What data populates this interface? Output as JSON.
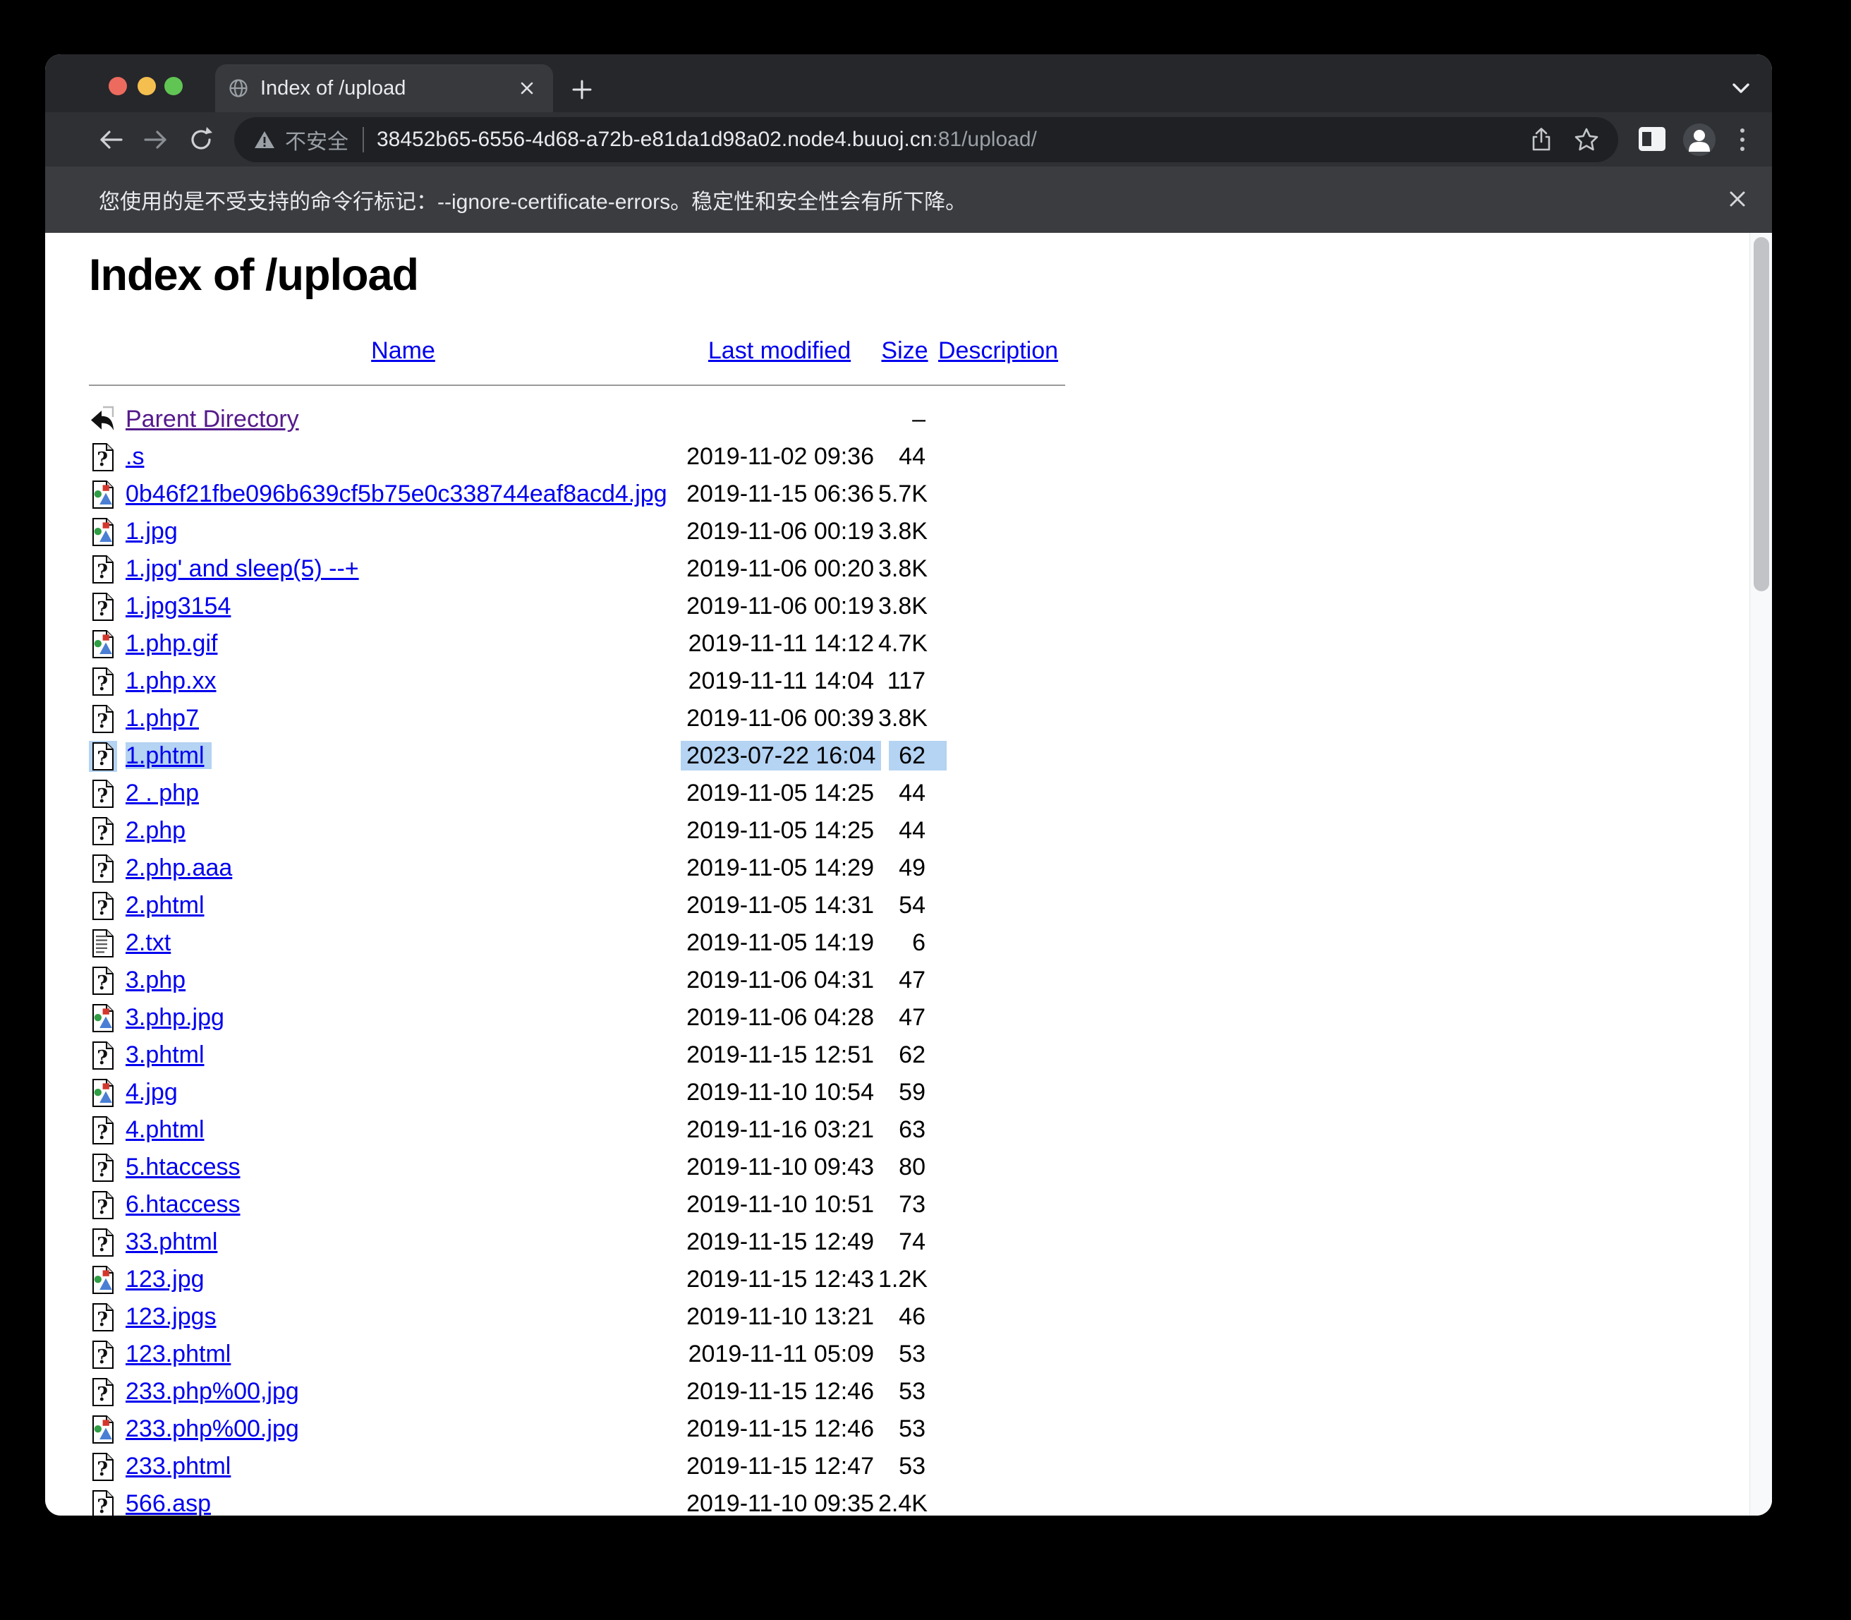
{
  "window": {
    "traffic_lights": {
      "close": "#ed6a5e",
      "minimize": "#f4bf4f",
      "zoom": "#61c554"
    }
  },
  "tab": {
    "title": "Index of /upload",
    "favicon": "globe-icon"
  },
  "toolbar": {
    "security_label": "不安全",
    "url_host": "38452b65-6556-4d68-a72b-e81da1d98a02.node4.buuoj.cn",
    "url_path": ":81/upload/"
  },
  "infobar": {
    "message": "您使用的是不受支持的命令行标记：--ignore-certificate-errors。稳定性和安全性会有所下降。"
  },
  "page": {
    "heading": "Index of /upload",
    "columns": {
      "name": "Name",
      "modified": "Last modified",
      "size": "Size",
      "description": "Description"
    },
    "rows": [
      {
        "icon": "back",
        "name": "Parent Directory",
        "modified": "",
        "size": "–",
        "visited": true,
        "selected": false
      },
      {
        "icon": "unknown",
        "name": ".s",
        "modified": "2019-11-02 09:36",
        "size": "44",
        "visited": false,
        "selected": false
      },
      {
        "icon": "image",
        "name": "0b46f21fbe096b639cf5b75e0c338744eaf8acd4.jpg",
        "modified": "2019-11-15 06:36",
        "size": "5.7K",
        "visited": false,
        "selected": false
      },
      {
        "icon": "image",
        "name": "1.jpg",
        "modified": "2019-11-06 00:19",
        "size": "3.8K",
        "visited": false,
        "selected": false
      },
      {
        "icon": "unknown",
        "name": "1.jpg' and sleep(5) --+",
        "modified": "2019-11-06 00:20",
        "size": "3.8K",
        "visited": false,
        "selected": false
      },
      {
        "icon": "unknown",
        "name": "1.jpg3154",
        "modified": "2019-11-06 00:19",
        "size": "3.8K",
        "visited": false,
        "selected": false
      },
      {
        "icon": "image",
        "name": "1.php.gif",
        "modified": "2019-11-11 14:12",
        "size": "4.7K",
        "visited": false,
        "selected": false
      },
      {
        "icon": "unknown",
        "name": "1.php.xx",
        "modified": "2019-11-11 14:04",
        "size": "117",
        "visited": false,
        "selected": false
      },
      {
        "icon": "unknown",
        "name": "1.php7",
        "modified": "2019-11-06 00:39",
        "size": "3.8K",
        "visited": false,
        "selected": false
      },
      {
        "icon": "unknown",
        "name": "1.phtml",
        "modified": "2023-07-22 16:04",
        "size": "62",
        "visited": false,
        "selected": true
      },
      {
        "icon": "unknown",
        "name": "2 . php",
        "modified": "2019-11-05 14:25",
        "size": "44",
        "visited": false,
        "selected": false
      },
      {
        "icon": "unknown",
        "name": "2.php",
        "modified": "2019-11-05 14:25",
        "size": "44",
        "visited": false,
        "selected": false
      },
      {
        "icon": "unknown",
        "name": "2.php.aaa",
        "modified": "2019-11-05 14:29",
        "size": "49",
        "visited": false,
        "selected": false
      },
      {
        "icon": "unknown",
        "name": "2.phtml",
        "modified": "2019-11-05 14:31",
        "size": "54",
        "visited": false,
        "selected": false
      },
      {
        "icon": "text",
        "name": "2.txt",
        "modified": "2019-11-05 14:19",
        "size": "6",
        "visited": false,
        "selected": false
      },
      {
        "icon": "unknown",
        "name": "3.php",
        "modified": "2019-11-06 04:31",
        "size": "47",
        "visited": false,
        "selected": false
      },
      {
        "icon": "image",
        "name": "3.php.jpg",
        "modified": "2019-11-06 04:28",
        "size": "47",
        "visited": false,
        "selected": false
      },
      {
        "icon": "unknown",
        "name": "3.phtml",
        "modified": "2019-11-15 12:51",
        "size": "62",
        "visited": false,
        "selected": false
      },
      {
        "icon": "image",
        "name": "4.jpg",
        "modified": "2019-11-10 10:54",
        "size": "59",
        "visited": false,
        "selected": false
      },
      {
        "icon": "unknown",
        "name": "4.phtml",
        "modified": "2019-11-16 03:21",
        "size": "63",
        "visited": false,
        "selected": false
      },
      {
        "icon": "unknown",
        "name": "5.htaccess",
        "modified": "2019-11-10 09:43",
        "size": "80",
        "visited": false,
        "selected": false
      },
      {
        "icon": "unknown",
        "name": "6.htaccess",
        "modified": "2019-11-10 10:51",
        "size": "73",
        "visited": false,
        "selected": false
      },
      {
        "icon": "unknown",
        "name": "33.phtml",
        "modified": "2019-11-15 12:49",
        "size": "74",
        "visited": false,
        "selected": false
      },
      {
        "icon": "image",
        "name": "123.jpg",
        "modified": "2019-11-15 12:43",
        "size": "1.2K",
        "visited": false,
        "selected": false
      },
      {
        "icon": "unknown",
        "name": "123.jpgs",
        "modified": "2019-11-10 13:21",
        "size": "46",
        "visited": false,
        "selected": false
      },
      {
        "icon": "unknown",
        "name": "123.phtml",
        "modified": "2019-11-11 05:09",
        "size": "53",
        "visited": false,
        "selected": false
      },
      {
        "icon": "unknown",
        "name": "233.php%00,jpg",
        "modified": "2019-11-15 12:46",
        "size": "53",
        "visited": false,
        "selected": false
      },
      {
        "icon": "image",
        "name": "233.php%00.jpg",
        "modified": "2019-11-15 12:46",
        "size": "53",
        "visited": false,
        "selected": false
      },
      {
        "icon": "unknown",
        "name": "233.phtml",
        "modified": "2019-11-15 12:47",
        "size": "53",
        "visited": false,
        "selected": false
      },
      {
        "icon": "unknown",
        "name": "566.asp",
        "modified": "2019-11-10 09:35",
        "size": "2.4K",
        "visited": false,
        "selected": false
      }
    ]
  },
  "colors": {
    "link": "#0000EE",
    "visited_link": "#551A8B",
    "selection_highlight": "#b5d3f2"
  }
}
